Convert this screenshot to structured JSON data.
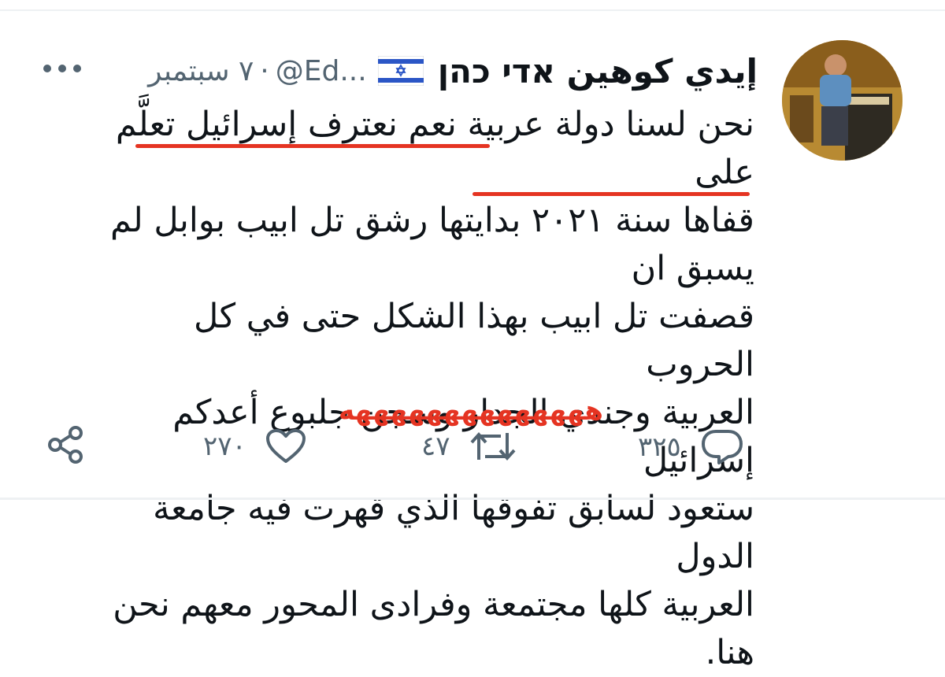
{
  "tweet": {
    "author_name": "إيدي كوهين אדי כהן",
    "handle": "@Ed...",
    "separator": "·",
    "date": "٧ سبتمبر",
    "text": "نحن لسنا دولة عربية نعم نعترف إسرائيل تعلَّم على\nقفاها سنة ٢٠٢١ بدايتها رشق تل ابيب بوابل لم يسبق ان\nقصفت تل ابيب بهذا الشكل حتى في كل الحروب\nالعربية وجندي الجدار وسجن جلبوع أعدكم إسرائيل\nستعود لسابق تفوقها الذي قهرت فيه جامعة الدول\nالعربية كلها مجتمعة وفرادى المحور معهم نحن هنا.",
    "annotation_scribble": "ههههههههههههههه",
    "replies": "٣٢٥",
    "retweets": "٤٧",
    "likes": "٢٧٠"
  },
  "colors": {
    "accent_underline": "#e53422",
    "muted_text": "#536471",
    "flag_blue": "#2b56c6"
  },
  "icons": [
    "more-icon",
    "israel-flag-icon",
    "reply-icon",
    "retweet-icon",
    "like-icon",
    "share-icon"
  ]
}
